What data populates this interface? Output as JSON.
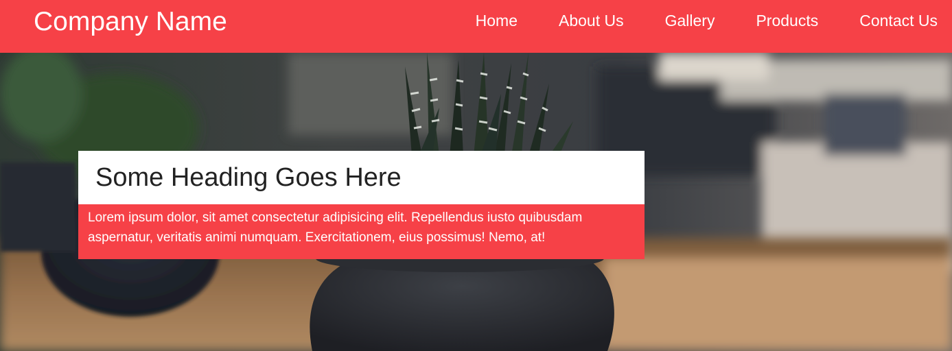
{
  "colors": {
    "accent": "#f64147",
    "header_text": "#ffffff",
    "heading_bg": "#ffffff",
    "heading_text": "#222222"
  },
  "header": {
    "brand": "Company Name",
    "nav": [
      {
        "label": "Home"
      },
      {
        "label": "About Us"
      },
      {
        "label": "Gallery"
      },
      {
        "label": "Products"
      },
      {
        "label": "Contact Us"
      }
    ]
  },
  "hero": {
    "image": "blurred-room-with-potted-succulent-photo",
    "heading": "Some Heading Goes Here",
    "text": "Lorem ipsum dolor, sit amet consectetur adipisicing elit. Repellendus iusto quibusdam aspernatur, veritatis animi numquam. Exercitationem, eius possimus! Nemo, at!"
  }
}
